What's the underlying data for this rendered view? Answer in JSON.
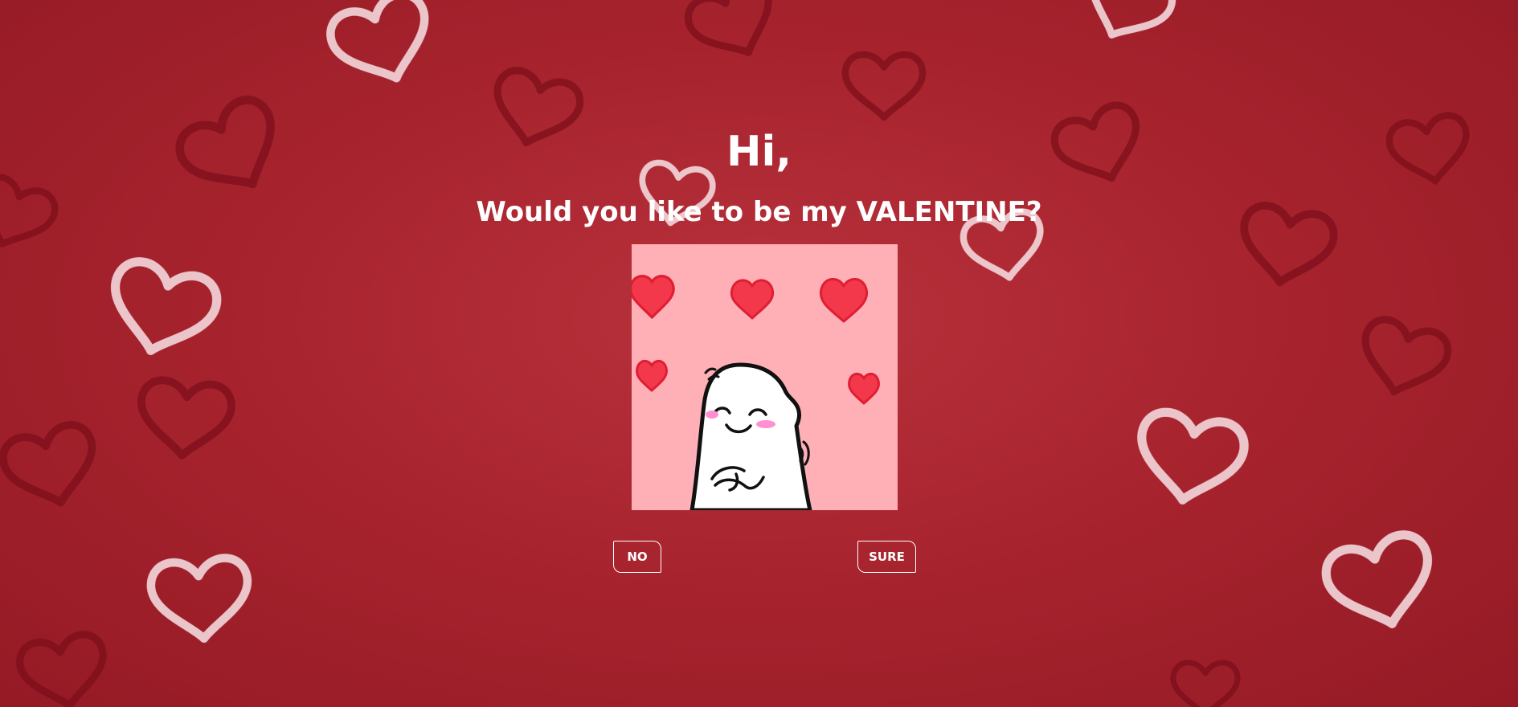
{
  "greeting": "Hi,",
  "question": "Would you like to be my VALENTINE?",
  "buttons": {
    "no_label": "NO",
    "sure_label": "SURE"
  },
  "sticker": {
    "icon": "shy-ghost-with-hearts",
    "background": "#ffb0b6",
    "heart_color": "#f2384a"
  },
  "background": {
    "icon": "paper-hearts",
    "base_color": "#a8242e"
  }
}
